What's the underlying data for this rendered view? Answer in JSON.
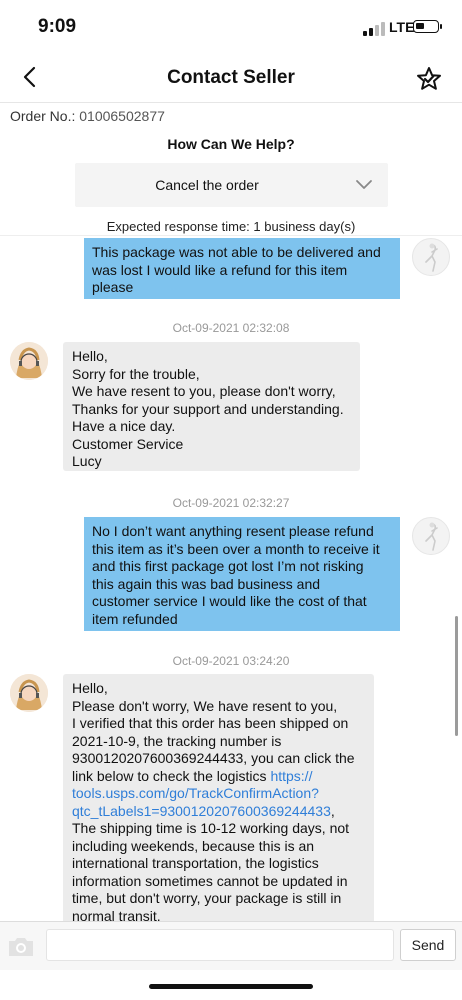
{
  "status_bar": {
    "time": "9:09",
    "network": "LTE"
  },
  "header": {
    "title": "Contact Seller"
  },
  "order": {
    "label": "Order No.:",
    "number": "01006502877"
  },
  "help": {
    "heading": "How Can We Help?",
    "topic_selected": "Cancel the order",
    "expected_response": "Expected response time: 1 business day(s)"
  },
  "messages": [
    {
      "from": "customer",
      "text": "This package was not able to be delivered and\nwas lost I would like a refund for this item\nplease"
    },
    {
      "timestamp": "Oct-09-2021 02:32:08"
    },
    {
      "from": "seller",
      "text": "Hello,\nSorry for the trouble,\nWe have resent to you, please don't worry,\nThanks for your support and understanding.\nHave a nice day.\nCustomer Service\nLucy"
    },
    {
      "timestamp": "Oct-09-2021 02:32:27"
    },
    {
      "from": "customer",
      "text": "No I don’t want anything resent please refund\nthis item as it’s been over a month to receive it\nand this first package got lost I’m not risking\nthis again this was bad business and\ncustomer service I would like the cost of that\nitem refunded"
    },
    {
      "timestamp": "Oct-09-2021 03:24:20"
    },
    {
      "from": "seller",
      "text_before_link": "Hello,\nPlease don't worry, We have resent to you,\nI verified that this order has been shipped on\n2021-10-9, the tracking number is\n9300120207600369244433, you can click the\nlink below to check the logistics ",
      "link": "https://\ntools.usps.com/go/TrackConfirmAction?\nqtc_tLabels1=9300120207600369244433",
      "text_after_link": ",\nThe shipping time is 10-12 working days, not\nincluding weekends, because this is an\ninternational transportation, the logistics\ninformation sometimes cannot be updated in\ntime, but don't worry, your package is still in\nnormal transit.\nThank for your support and understanding."
    }
  ],
  "composer": {
    "send_label": "Send",
    "placeholder": ""
  }
}
